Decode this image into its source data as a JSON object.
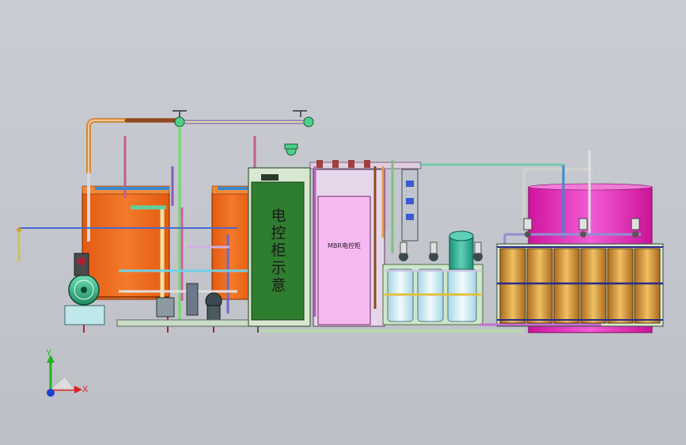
{
  "panels": {
    "control_cabinet_label": "电控柜示意",
    "mbr_cabinet_label": "MBR电控柜"
  },
  "triad": {
    "x_label": "X",
    "y_label": "Y",
    "x_color": "#e02020",
    "y_color": "#20b020",
    "z_color": "#1f3fd0"
  },
  "colors": {
    "background": "#c6c9cf",
    "orange_tank": "#f26a1e",
    "green_cabinet": "#2a7a2a",
    "pink_cabinet": "#f6b6f0",
    "magenta_tank": "#e81ec0",
    "copper_drum": "#d9a040",
    "cyan_cartridge": "#d8f4f8",
    "teal_column": "#33b39a"
  }
}
